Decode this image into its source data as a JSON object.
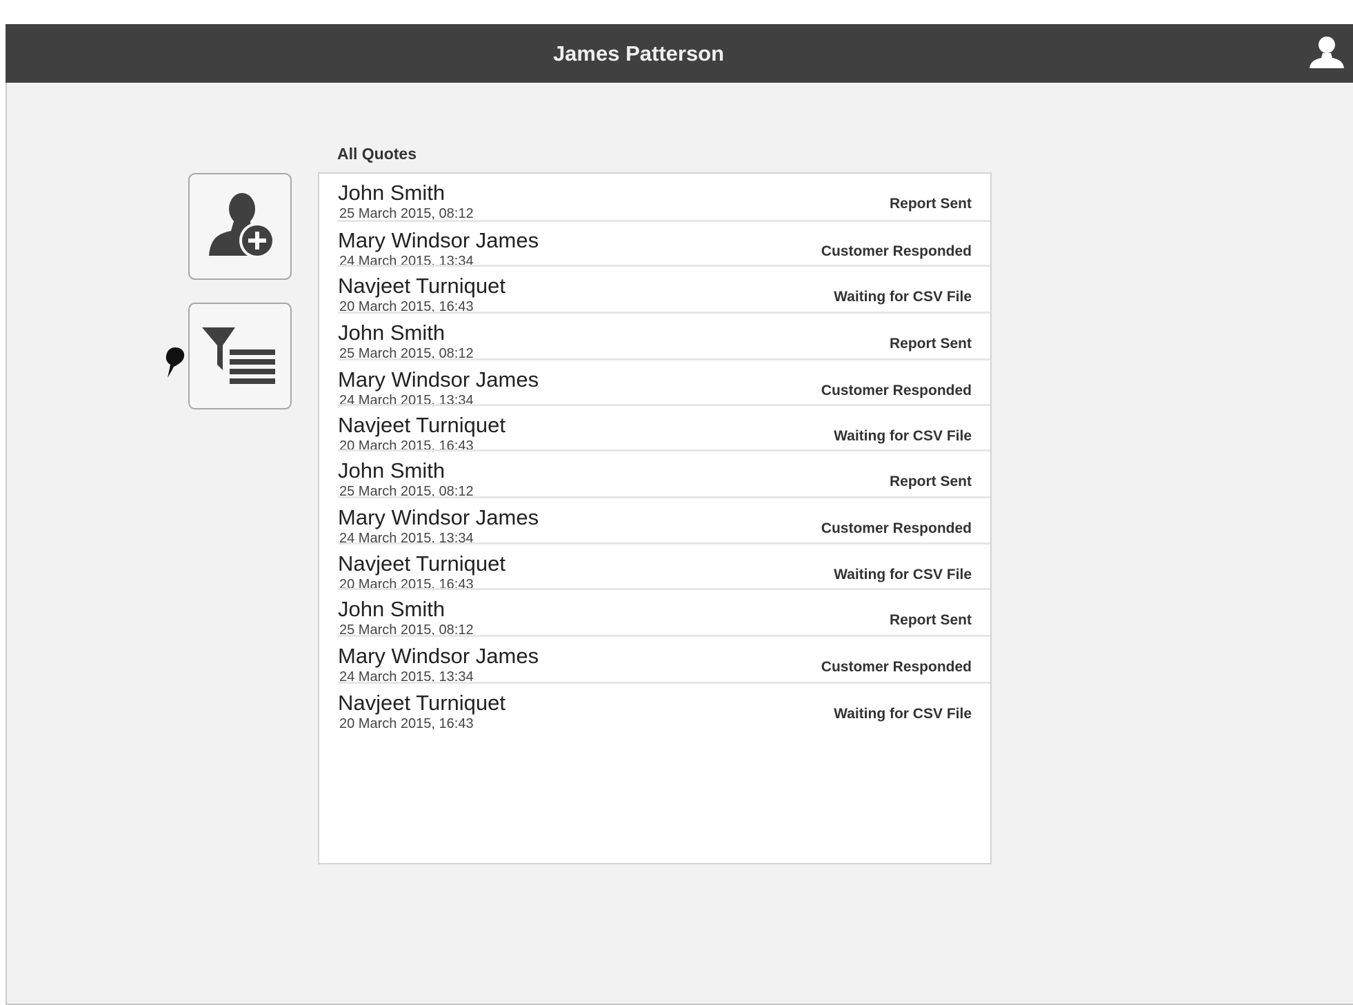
{
  "header": {
    "title": "James Patterson",
    "user_icon": "user-icon"
  },
  "actions": {
    "add_customer_icon": "user-add-icon",
    "filter_icon": "filter-list-icon"
  },
  "list": {
    "heading": "All Quotes",
    "rows": [
      {
        "name": "John Smith",
        "date": "25 March 2015, 08:12",
        "status": "Report Sent"
      },
      {
        "name": "Mary Windsor James",
        "date": "24 March 2015, 13:34",
        "status": "Customer Responded"
      },
      {
        "name": "Navjeet Turniquet",
        "date": "20 March 2015, 16:43",
        "status": "Waiting for CSV File"
      },
      {
        "name": "John Smith",
        "date": "25 March 2015, 08:12",
        "status": "Report Sent"
      },
      {
        "name": "Mary Windsor James",
        "date": "24 March 2015, 13:34",
        "status": "Customer Responded"
      },
      {
        "name": "Navjeet Turniquet",
        "date": "20 March 2015, 16:43",
        "status": "Waiting for CSV File"
      },
      {
        "name": "John Smith",
        "date": "25 March 2015, 08:12",
        "status": "Report Sent"
      },
      {
        "name": "Mary Windsor James",
        "date": "24 March 2015, 13:34",
        "status": "Customer Responded"
      },
      {
        "name": "Navjeet Turniquet",
        "date": "20 March 2015, 16:43",
        "status": "Waiting for CSV File"
      },
      {
        "name": "John Smith",
        "date": "25 March 2015, 08:12",
        "status": "Report Sent"
      },
      {
        "name": "Mary Windsor James",
        "date": "24 March 2015, 13:34",
        "status": "Customer Responded"
      },
      {
        "name": "Navjeet Turniquet",
        "date": "20 March 2015, 16:43",
        "status": "Waiting for CSV File"
      }
    ]
  }
}
